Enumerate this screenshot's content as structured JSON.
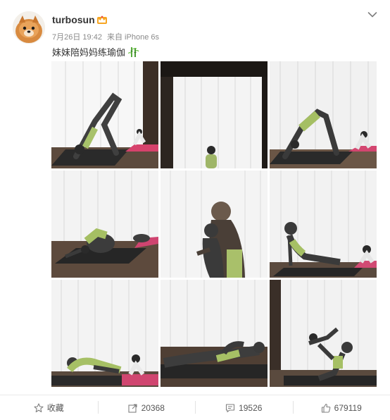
{
  "post": {
    "username": "turbosun",
    "date": "7月26日 19:42",
    "source": "来自 iPhone 6s",
    "text": "妹妹陪妈妈练瑜伽",
    "icons": {
      "avatar": "pomeranian-dog-avatar",
      "badge": "vip-crown-icon",
      "menu": "chevron-down-icon",
      "emoji": "bamboo-emoji-icon"
    }
  },
  "photos": [
    {
      "scene": "downward-dog-with-child"
    },
    {
      "scene": "child-at-window"
    },
    {
      "scene": "downward-dog-with-child"
    },
    {
      "scene": "child-pose-with-child"
    },
    {
      "scene": "mother-holding-child"
    },
    {
      "scene": "upward-dog-with-child"
    },
    {
      "scene": "seated-stretch-with-child"
    },
    {
      "scene": "lying-with-child"
    },
    {
      "scene": "airplane-lift-child"
    }
  ],
  "actions": {
    "favorite": {
      "label": "收藏",
      "icon": "star-icon"
    },
    "repost": {
      "label": "20368",
      "icon": "share-icon"
    },
    "comment": {
      "label": "19526",
      "icon": "comment-icon"
    },
    "like": {
      "label": "679119",
      "icon": "thumbs-up-icon"
    }
  },
  "colors": {
    "username": "#333333",
    "meta": "#8a8a8a",
    "mat_pink": "#e2557a",
    "mat_dark": "#2b2b2b",
    "curtain": "#f4f4f4",
    "floor": "#5a4a3e"
  }
}
